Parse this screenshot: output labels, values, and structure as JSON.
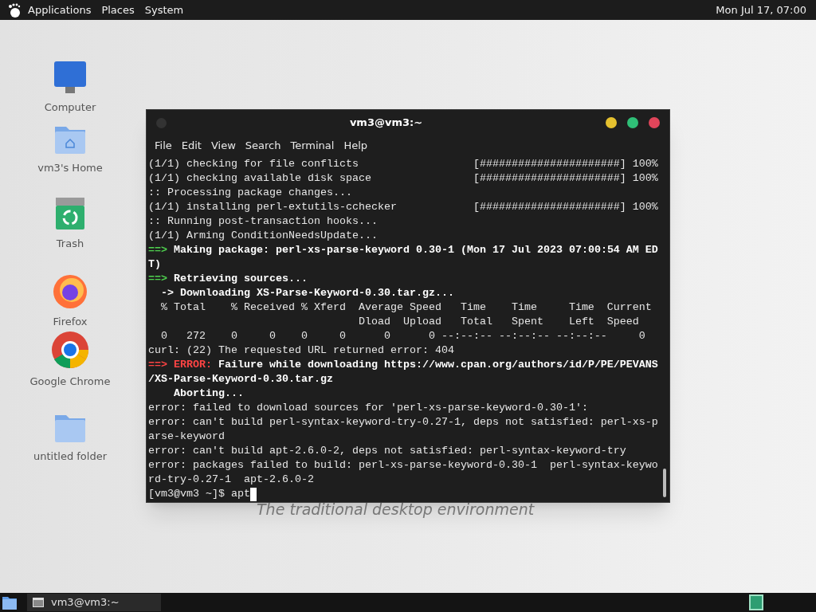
{
  "top_panel": {
    "menus": [
      "Applications",
      "Places",
      "System"
    ],
    "clock": "Mon Jul 17, 07:00"
  },
  "desktop_icons": [
    {
      "label": "Computer",
      "kind": "computer"
    },
    {
      "label": "vm3's Home",
      "kind": "home"
    },
    {
      "label": "Trash",
      "kind": "trash"
    },
    {
      "label": "Firefox",
      "kind": "firefox"
    },
    {
      "label": "Google Chrome",
      "kind": "chrome"
    },
    {
      "label": "untitled folder",
      "kind": "folder"
    }
  ],
  "wallpaper_caption": "The traditional desktop environment",
  "terminal": {
    "title": "vm3@vm3:~",
    "menu": [
      "File",
      "Edit",
      "View",
      "Search",
      "Terminal",
      "Help"
    ],
    "lines": [
      [
        {
          "text": "(1/1) checking for file conflicts                  [######################] 100%",
          "kind": "plain"
        }
      ],
      [
        {
          "text": "(1/1) checking available disk space                [######################] 100%",
          "kind": "plain"
        }
      ],
      [
        {
          "text": ":: Processing package changes...",
          "kind": "plain"
        }
      ],
      [
        {
          "text": "(1/1) installing perl-extutils-cchecker            [######################] 100%",
          "kind": "plain"
        }
      ],
      [
        {
          "text": ":: Running post-transaction hooks...",
          "kind": "plain"
        }
      ],
      [
        {
          "text": "(1/1) Arming ConditionNeedsUpdate...",
          "kind": "plain"
        }
      ],
      [
        {
          "text": "==> ",
          "kind": "arrow"
        },
        {
          "text": "Making package: perl-xs-parse-keyword 0.30-1 (Mon 17 Jul 2023 07:00:54 AM ED",
          "kind": "bold"
        }
      ],
      [
        {
          "text": "T)",
          "kind": "bold"
        }
      ],
      [
        {
          "text": "==> ",
          "kind": "arrow"
        },
        {
          "text": "Retrieving sources...",
          "kind": "bold"
        }
      ],
      [
        {
          "text": "  -> Downloading XS-Parse-Keyword-0.30.tar.gz...",
          "kind": "bold"
        }
      ],
      [
        {
          "text": "  % Total    % Received % Xferd  Average Speed   Time    Time     Time  Current",
          "kind": "plain"
        }
      ],
      [
        {
          "text": "                                 Dload  Upload   Total   Spent    Left  Speed",
          "kind": "plain"
        }
      ],
      [
        {
          "text": "  0   272    0     0    0     0      0      0 --:--:-- --:--:-- --:--:--     0",
          "kind": "plain"
        }
      ],
      [
        {
          "text": "curl: (22) The requested URL returned error: 404",
          "kind": "plain"
        }
      ],
      [
        {
          "text": "==> ERROR:",
          "kind": "error"
        },
        {
          "text": " Failure while downloading https://www.cpan.org/authors/id/P/PE/PEVANS",
          "kind": "bold"
        }
      ],
      [
        {
          "text": "/XS-Parse-Keyword-0.30.tar.gz",
          "kind": "bold"
        }
      ],
      [
        {
          "text": "    Aborting...",
          "kind": "bold"
        }
      ],
      [
        {
          "text": "error: failed to download sources for 'perl-xs-parse-keyword-0.30-1':",
          "kind": "plain"
        }
      ],
      [
        {
          "text": "error: can't build perl-syntax-keyword-try-0.27-1, deps not satisfied: perl-xs-p",
          "kind": "plain"
        }
      ],
      [
        {
          "text": "arse-keyword",
          "kind": "plain"
        }
      ],
      [
        {
          "text": "error: can't build apt-2.6.0-2, deps not satisfied: perl-syntax-keyword-try",
          "kind": "plain"
        }
      ],
      [
        {
          "text": "error: packages failed to build: perl-xs-parse-keyword-0.30-1  perl-syntax-keywo",
          "kind": "plain"
        }
      ],
      [
        {
          "text": "rd-try-0.27-1  apt-2.6.0-2",
          "kind": "plain"
        }
      ]
    ],
    "prompt": "[vm3@vm3 ~]$ apt"
  },
  "taskbar": {
    "tasks": [
      {
        "label": "vm3@vm3:~",
        "selected": false
      }
    ]
  }
}
